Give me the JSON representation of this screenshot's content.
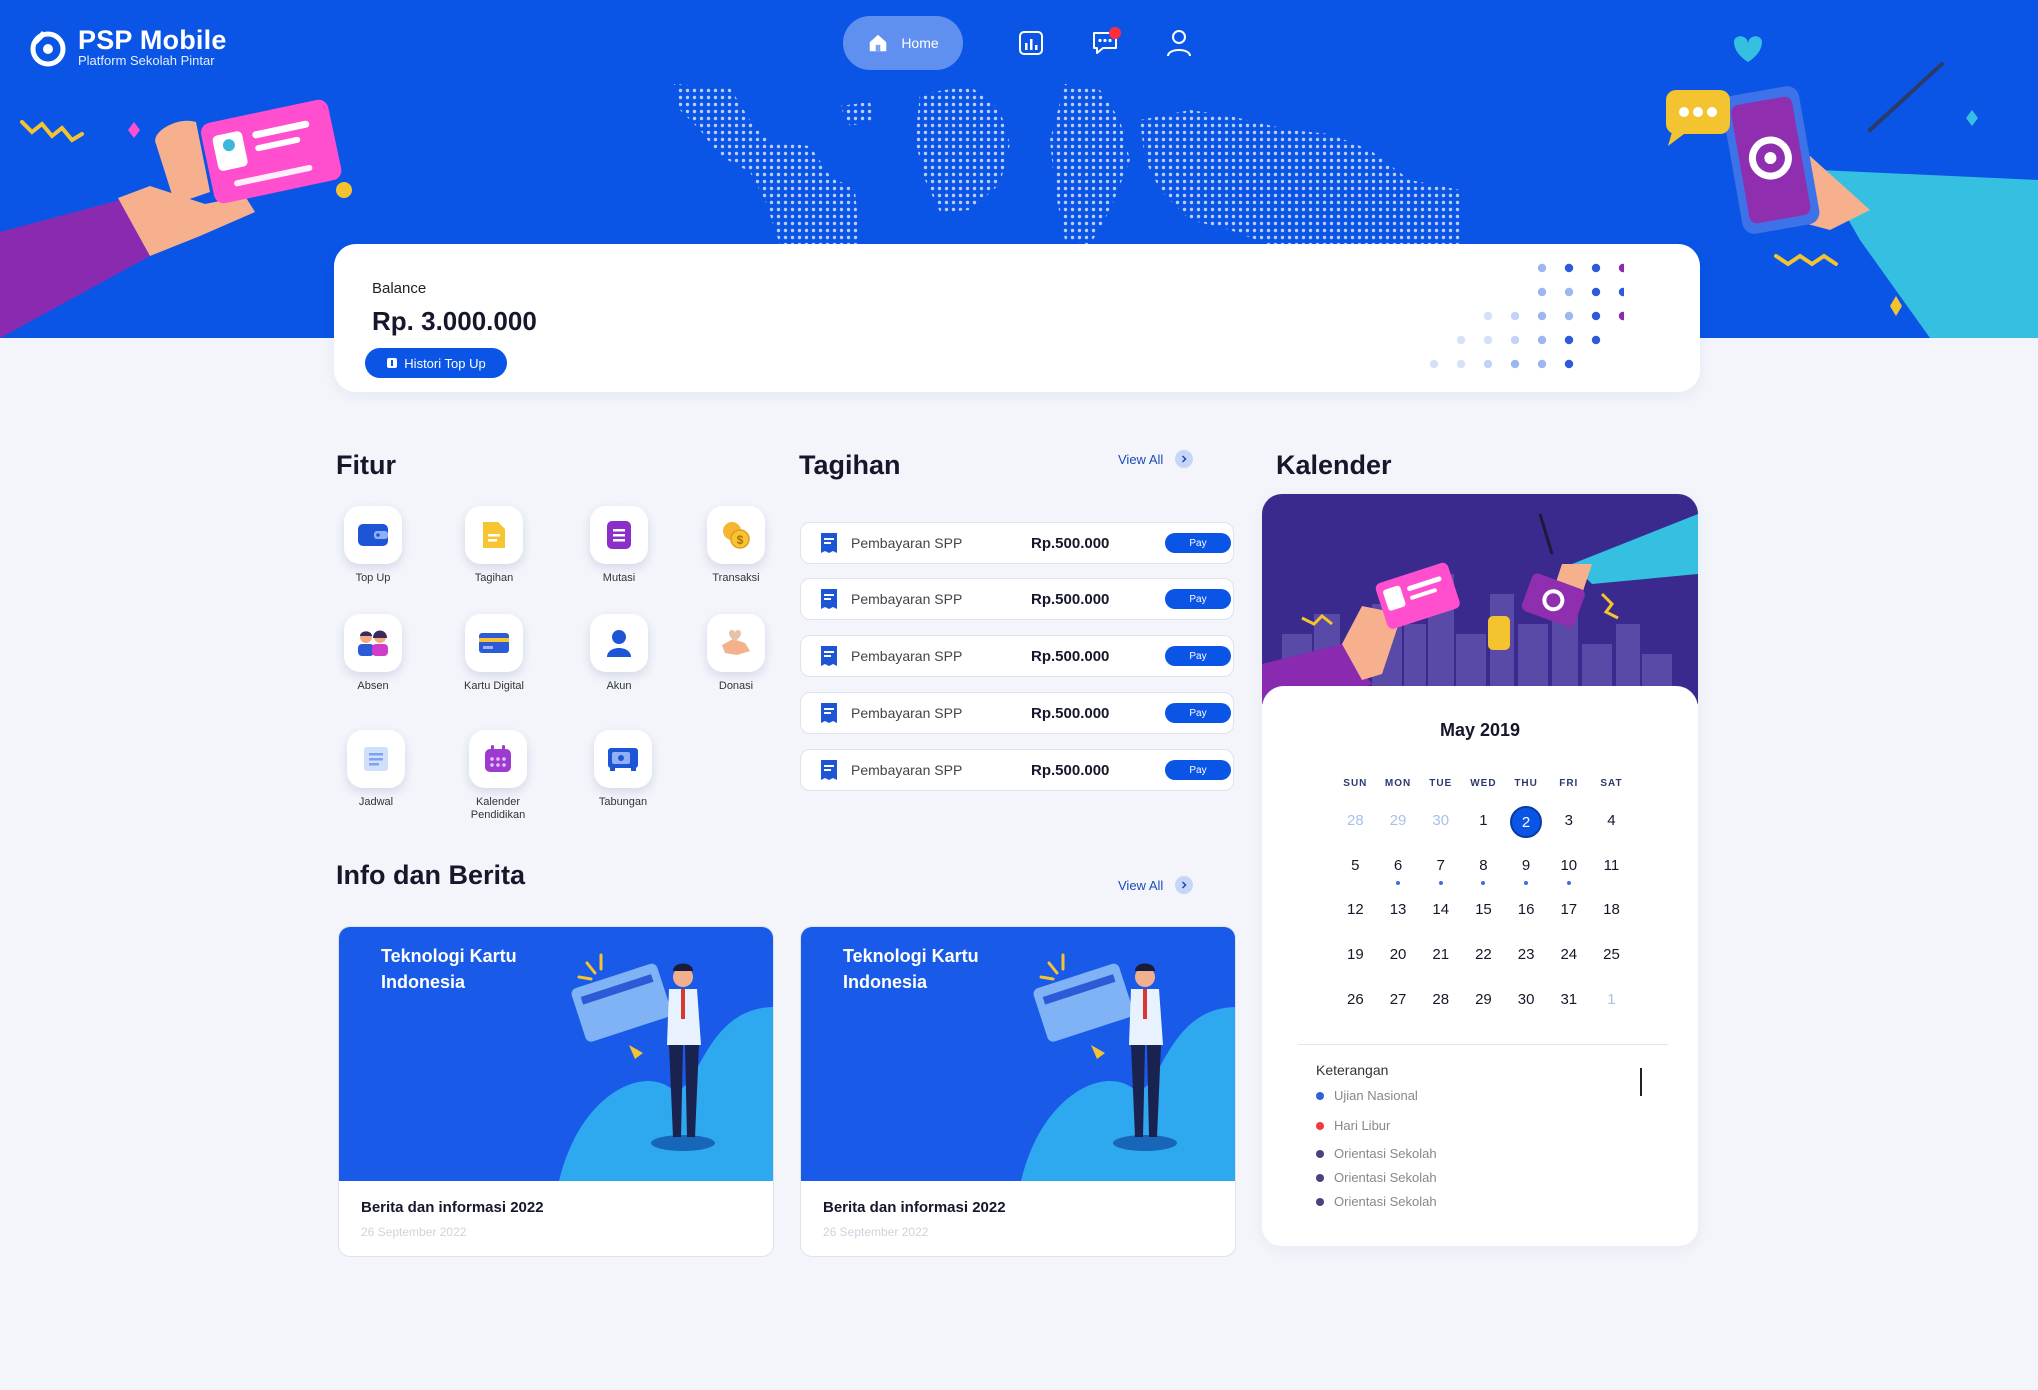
{
  "app": {
    "name": "PSP Mobile",
    "tagline": "Platform Sekolah Pintar"
  },
  "nav": {
    "home_label": "Home",
    "icons": [
      "home-icon",
      "report-icon",
      "chat-icon",
      "profile-icon"
    ]
  },
  "balance": {
    "label": "Balance",
    "amount": "Rp. 3.000.000",
    "history_label": "Histori Top Up"
  },
  "fitur": {
    "title": "Fitur",
    "items": [
      {
        "label": "Top Up",
        "icon": "wallet-icon"
      },
      {
        "label": "Tagihan",
        "icon": "document-icon"
      },
      {
        "label": "Mutasi",
        "icon": "list-icon"
      },
      {
        "label": "Transaksi",
        "icon": "coins-icon"
      },
      {
        "label": "Absen",
        "icon": "people-icon"
      },
      {
        "label": "Kartu Digital",
        "icon": "card-icon"
      },
      {
        "label": "Akun",
        "icon": "user-icon"
      },
      {
        "label": "Donasi",
        "icon": "donate-icon"
      },
      {
        "label": "Jadwal",
        "icon": "schedule-icon"
      },
      {
        "label": "Kalender Pendidikan",
        "icon": "calendar-icon"
      },
      {
        "label": "Tabungan",
        "icon": "safe-icon"
      }
    ]
  },
  "tagihan": {
    "title": "Tagihan",
    "view_all": "View All",
    "items": [
      {
        "name": "Pembayaran SPP",
        "amount": "Rp.500.000",
        "action": "Pay"
      },
      {
        "name": "Pembayaran SPP",
        "amount": "Rp.500.000",
        "action": "Pay"
      },
      {
        "name": "Pembayaran SPP",
        "amount": "Rp.500.000",
        "action": "Pay"
      },
      {
        "name": "Pembayaran SPP",
        "amount": "Rp.500.000",
        "action": "Pay"
      },
      {
        "name": "Pembayaran SPP",
        "amount": "Rp.500.000",
        "action": "Pay"
      }
    ]
  },
  "berita": {
    "title": "Info dan Berita",
    "view_all": "View All",
    "items": [
      {
        "image_title": "Teknologi Kartu Indonesia",
        "title": "Berita dan informasi 2022",
        "date": "26 September 2022"
      },
      {
        "image_title": "Teknologi Kartu Indonesia",
        "title": "Berita dan informasi 2022",
        "date": "26 September 2022"
      }
    ]
  },
  "kalender": {
    "title": "Kalender",
    "month": "May 2019",
    "dow": [
      "SUN",
      "MON",
      "TUE",
      "WED",
      "THU",
      "FRI",
      "SAT"
    ],
    "weeks": [
      [
        {
          "d": "28",
          "m": true
        },
        {
          "d": "29",
          "m": true
        },
        {
          "d": "30",
          "m": true
        },
        {
          "d": "1"
        },
        {
          "d": "2",
          "sel": true
        },
        {
          "d": "3"
        },
        {
          "d": "4"
        }
      ],
      [
        {
          "d": "5"
        },
        {
          "d": "6",
          "e": true
        },
        {
          "d": "7",
          "e": true
        },
        {
          "d": "8",
          "e": true
        },
        {
          "d": "9",
          "e": true
        },
        {
          "d": "10",
          "e": true
        },
        {
          "d": "11"
        }
      ],
      [
        {
          "d": "12"
        },
        {
          "d": "13"
        },
        {
          "d": "14"
        },
        {
          "d": "15"
        },
        {
          "d": "16"
        },
        {
          "d": "17"
        },
        {
          "d": "18"
        }
      ],
      [
        {
          "d": "19"
        },
        {
          "d": "20"
        },
        {
          "d": "21"
        },
        {
          "d": "22"
        },
        {
          "d": "23"
        },
        {
          "d": "24"
        },
        {
          "d": "25"
        }
      ],
      [
        {
          "d": "26"
        },
        {
          "d": "27"
        },
        {
          "d": "28"
        },
        {
          "d": "29"
        },
        {
          "d": "30"
        },
        {
          "d": "31"
        },
        {
          "d": "1",
          "m": true
        }
      ]
    ],
    "legend_title": "Keterangan",
    "legend": [
      {
        "label": "Ujian Nasional",
        "color": "#2f62d8"
      },
      {
        "label": "Hari Libur",
        "color": "#ee3b3b"
      },
      {
        "label": "Orientasi Sekolah",
        "color": "#4b4080"
      },
      {
        "label": "Orientasi Sekolah",
        "color": "#4b4080"
      },
      {
        "label": "Orientasi Sekolah",
        "color": "#4b4080"
      }
    ]
  },
  "colors": {
    "primary": "#0a55e6",
    "background": "#f3f5fb",
    "notification": "#ff2d3b"
  }
}
